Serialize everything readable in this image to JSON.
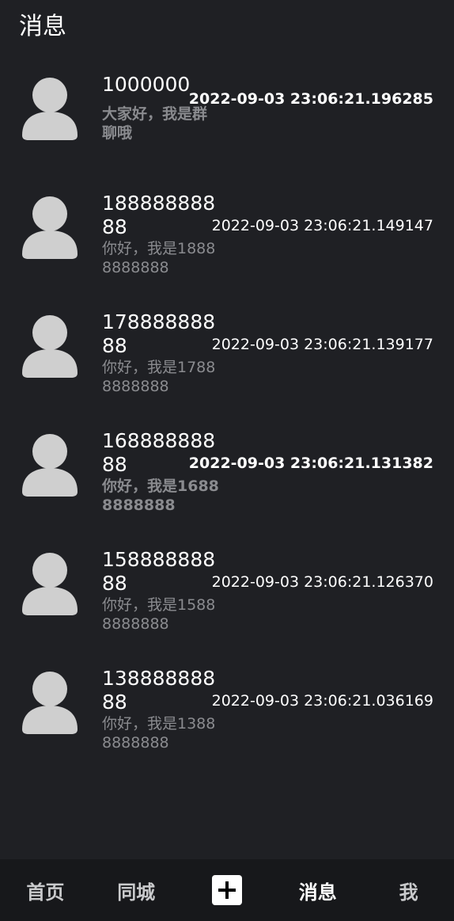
{
  "header": {
    "title": "消息"
  },
  "conversations": [
    {
      "name": "1000000",
      "preview": "大家好，我是群聊哦",
      "time": "2022-09-03 23:06:21.196285"
    },
    {
      "name": "18888888888",
      "preview": "你好，我是18888888888",
      "time": "2022-09-03 23:06:21.149147"
    },
    {
      "name": "17888888888",
      "preview": "你好，我是17888888888",
      "time": "2022-09-03 23:06:21.139177"
    },
    {
      "name": "16888888888",
      "preview": "你好，我是16888888888",
      "time": "2022-09-03 23:06:21.131382"
    },
    {
      "name": "15888888888",
      "preview": "你好，我是15888888888",
      "time": "2022-09-03 23:06:21.126370"
    },
    {
      "name": "13888888888",
      "preview": "你好，我是13888888888",
      "time": "2022-09-03 23:06:21.036169"
    }
  ],
  "tabbar": {
    "home": "首页",
    "local": "同城",
    "add_icon": "plus-icon",
    "messages": "消息",
    "me": "我"
  },
  "colors": {
    "background": "#1f2024",
    "tabbar_background": "#17181b",
    "avatar": "#cfcfcf",
    "preview_text": "#8a8b8f"
  }
}
